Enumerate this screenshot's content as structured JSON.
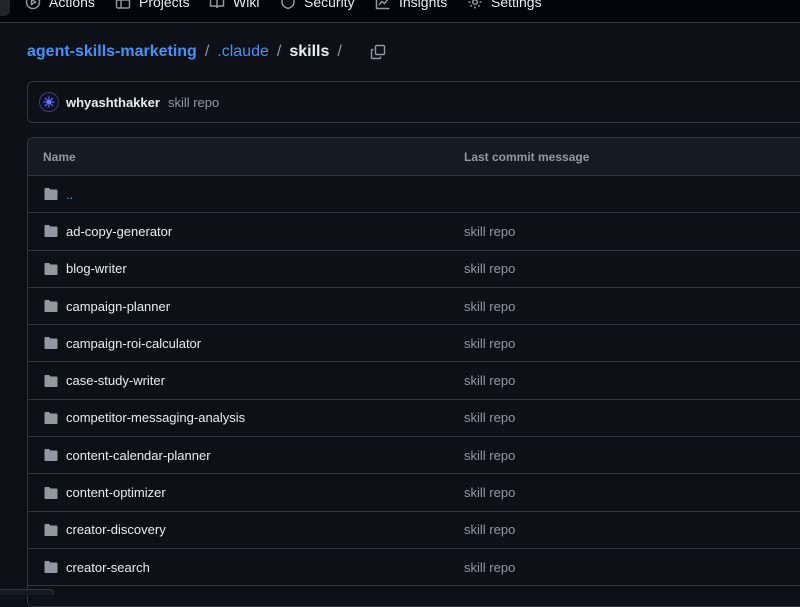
{
  "nav": {
    "tabs": [
      {
        "label": "Actions",
        "icon": "play-circle-icon"
      },
      {
        "label": "Projects",
        "icon": "table-icon"
      },
      {
        "label": "Wiki",
        "icon": "book-icon"
      },
      {
        "label": "Security",
        "icon": "shield-icon"
      },
      {
        "label": "Insights",
        "icon": "graph-icon"
      },
      {
        "label": "Settings",
        "icon": "gear-icon"
      }
    ]
  },
  "breadcrumb": {
    "repo": "agent-skills-marketing",
    "folder": ".claude",
    "current": "skills",
    "separator": "/"
  },
  "commit": {
    "user": "whyashthakker",
    "message": "skill repo"
  },
  "table": {
    "headers": {
      "name": "Name",
      "message": "Last commit message"
    },
    "parent": "..",
    "rows": [
      {
        "name": "ad-copy-generator",
        "message": "skill repo"
      },
      {
        "name": "blog-writer",
        "message": "skill repo"
      },
      {
        "name": "campaign-planner",
        "message": "skill repo"
      },
      {
        "name": "campaign-roi-calculator",
        "message": "skill repo"
      },
      {
        "name": "case-study-writer",
        "message": "skill repo"
      },
      {
        "name": "competitor-messaging-analysis",
        "message": "skill repo"
      },
      {
        "name": "content-calendar-planner",
        "message": "skill repo"
      },
      {
        "name": "content-optimizer",
        "message": "skill repo"
      },
      {
        "name": "creator-discovery",
        "message": "skill repo"
      },
      {
        "name": "creator-search",
        "message": "skill repo"
      }
    ]
  },
  "colors": {
    "background": "#0d1117",
    "border": "#30363d",
    "link": "#4493f8",
    "muted": "#9198a1",
    "text": "#e6edf3"
  }
}
